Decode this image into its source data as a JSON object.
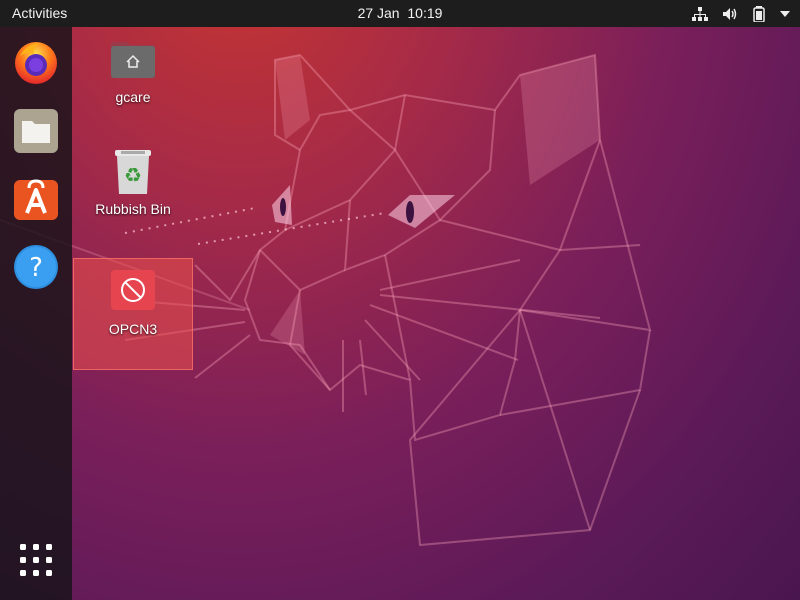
{
  "topbar": {
    "activities_label": "Activities",
    "date": "27 Jan",
    "time": "10:19",
    "tray_icons": [
      "network-icon",
      "volume-icon",
      "battery-icon",
      "system-menu-arrow-icon"
    ]
  },
  "dock": {
    "items": [
      {
        "name": "Firefox",
        "icon": "firefox-icon"
      },
      {
        "name": "Files",
        "icon": "files-icon"
      },
      {
        "name": "Ubuntu Software",
        "icon": "software-store-icon"
      },
      {
        "name": "Help",
        "icon": "help-icon"
      }
    ],
    "show_apps_icon": "app-grid-icon"
  },
  "desktop": {
    "icons": [
      {
        "label": "gcare",
        "icon": "home-folder-icon"
      },
      {
        "label": "Rubbish Bin",
        "icon": "trash-icon"
      },
      {
        "label": "OPCN3",
        "icon": "unavailable-icon",
        "selected": true
      }
    ]
  },
  "colors": {
    "topbar": "#1d1d1d",
    "accent": "#e95420",
    "selection": "#ed514c"
  }
}
